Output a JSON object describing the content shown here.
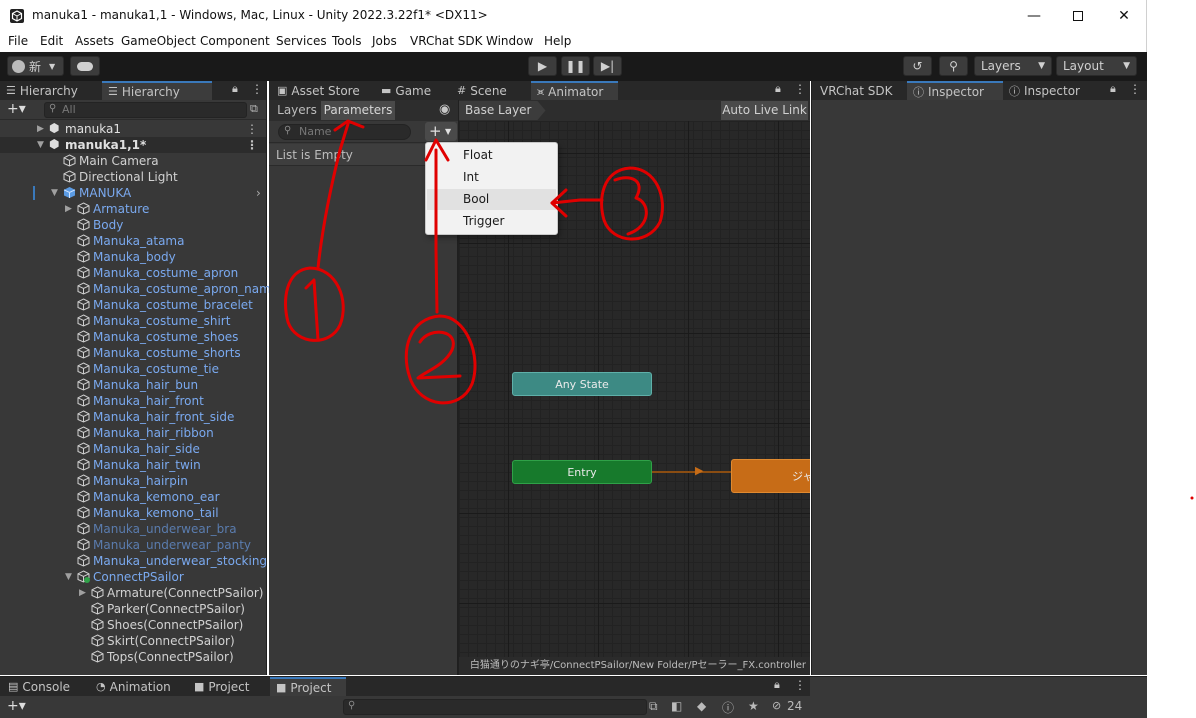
{
  "window": {
    "title": "manuka1 - manuka1,1 - Windows, Mac, Linux - Unity 2022.3.22f1* <DX11>",
    "controls": [
      "minimize",
      "maximize",
      "close"
    ]
  },
  "menu": [
    "File",
    "Edit",
    "Assets",
    "GameObject",
    "Component",
    "Services",
    "Tools",
    "Jobs",
    "VRChat SDK",
    "Window",
    "Help"
  ],
  "toolbar": {
    "account_label": "新",
    "layers_label": "Layers",
    "layout_label": "Layout"
  },
  "hierarchy": {
    "tabs": [
      "Hierarchy",
      "Hierarchy"
    ],
    "search_placeholder": "All",
    "rows": [
      {
        "label": "manuka1"
      },
      {
        "label": "manuka1,1*"
      },
      {
        "label": "Main Camera"
      },
      {
        "label": "Directional Light"
      },
      {
        "label": "MANUKA"
      },
      {
        "label": "Armature"
      },
      {
        "label": "Body"
      },
      {
        "label": "Manuka_atama"
      },
      {
        "label": "Manuka_body"
      },
      {
        "label": "Manuka_costume_apron"
      },
      {
        "label": "Manuka_costume_apron_name"
      },
      {
        "label": "Manuka_costume_bracelet"
      },
      {
        "label": "Manuka_costume_shirt"
      },
      {
        "label": "Manuka_costume_shoes"
      },
      {
        "label": "Manuka_costume_shorts"
      },
      {
        "label": "Manuka_costume_tie"
      },
      {
        "label": "Manuka_hair_bun"
      },
      {
        "label": "Manuka_hair_front"
      },
      {
        "label": "Manuka_hair_front_side"
      },
      {
        "label": "Manuka_hair_ribbon"
      },
      {
        "label": "Manuka_hair_side"
      },
      {
        "label": "Manuka_hair_twin"
      },
      {
        "label": "Manuka_hairpin"
      },
      {
        "label": "Manuka_kemono_ear"
      },
      {
        "label": "Manuka_kemono_tail"
      },
      {
        "label": "Manuka_underwear_bra"
      },
      {
        "label": "Manuka_underwear_panty"
      },
      {
        "label": "Manuka_underwear_stocking"
      },
      {
        "label": "ConnectPSailor"
      },
      {
        "label": "Armature(ConnectPSailor)"
      },
      {
        "label": "Parker(ConnectPSailor)"
      },
      {
        "label": "Shoes(ConnectPSailor)"
      },
      {
        "label": "Skirt(ConnectPSailor)"
      },
      {
        "label": "Tops(ConnectPSailor)"
      }
    ]
  },
  "center_tabs": [
    "Asset Store",
    "Game",
    "Scene",
    "Animator"
  ],
  "animator": {
    "subtabs": [
      "Layers",
      "Parameters"
    ],
    "breadcrumb": "Base Layer",
    "auto_live_link": "Auto Live Link",
    "name_placeholder": "Name",
    "list_empty": "List is Empty",
    "nodes": {
      "any_state": "Any State",
      "entry": "Entry",
      "default_state": "ジャ"
    },
    "path": "白猫通りのナギ亭/ConnectPSailor/New Folder/Pセーラー_FX.controller"
  },
  "context_menu": {
    "items": [
      "Float",
      "Int",
      "Bool",
      "Trigger"
    ],
    "hovered": "Bool"
  },
  "inspector_tabs": [
    "VRChat SDK",
    "Inspector",
    "Inspector"
  ],
  "bottom": {
    "tabs": [
      "Console",
      "Animation",
      "Project",
      "Project"
    ],
    "hidden_count": "24"
  },
  "annotations": [
    "①",
    "②",
    "③"
  ],
  "colors": {
    "accent": "#3a79bb",
    "annotation_red": "#e00000",
    "any_state": "#3d8a84",
    "entry": "#177a2c",
    "default_state": "#c76c17",
    "prefab_blue": "#7aa9ef"
  }
}
